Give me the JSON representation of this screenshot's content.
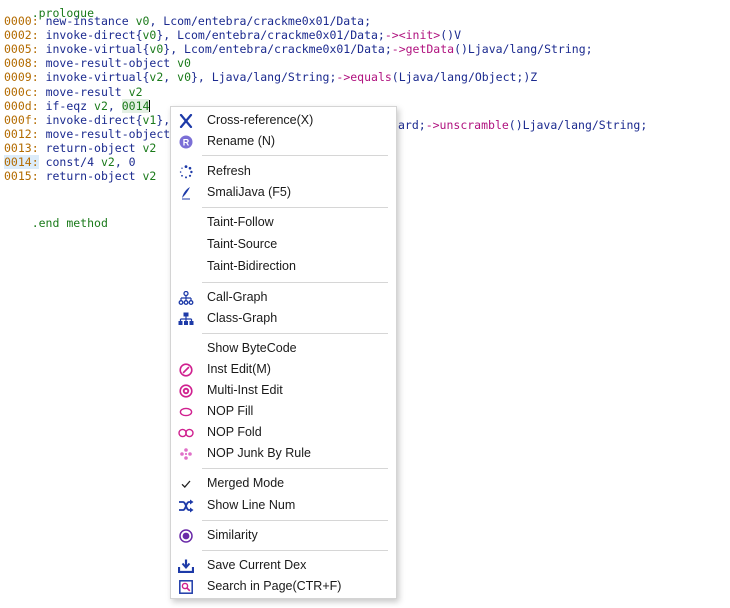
{
  "editor": {
    "header_fragment": ".prologue",
    "lines": [
      {
        "addr": "0000:",
        "parts": [
          {
            "t": "new-instance ",
            "c": "kw"
          },
          {
            "t": "v0",
            "c": "reg"
          },
          {
            "t": ", Lcom/entebra/crackme0x01/Data;",
            "c": "str"
          }
        ]
      },
      {
        "addr": "0002:",
        "parts": [
          {
            "t": "invoke-direct{",
            "c": "kw"
          },
          {
            "t": "v0",
            "c": "reg"
          },
          {
            "t": "}, Lcom/entebra/crackme0x01/Data;",
            "c": "str"
          },
          {
            "t": "-><init>",
            "c": "fn"
          },
          {
            "t": "()V",
            "c": "str"
          }
        ]
      },
      {
        "addr": "0005:",
        "parts": [
          {
            "t": "invoke-virtual{",
            "c": "kw"
          },
          {
            "t": "v0",
            "c": "reg"
          },
          {
            "t": "}, Lcom/entebra/crackme0x01/Data;",
            "c": "str"
          },
          {
            "t": "->getData",
            "c": "fn"
          },
          {
            "t": "()Ljava/lang/String;",
            "c": "str"
          }
        ]
      },
      {
        "addr": "0008:",
        "parts": [
          {
            "t": "move-result-object ",
            "c": "kw"
          },
          {
            "t": "v0",
            "c": "reg"
          }
        ]
      },
      {
        "addr": "0009:",
        "parts": [
          {
            "t": "invoke-virtual{",
            "c": "kw"
          },
          {
            "t": "v2",
            "c": "reg"
          },
          {
            "t": ", ",
            "c": "kw"
          },
          {
            "t": "v0",
            "c": "reg"
          },
          {
            "t": "}, Ljava/lang/String;",
            "c": "str"
          },
          {
            "t": "->equals",
            "c": "fn"
          },
          {
            "t": "(Ljava/lang/Object;)Z",
            "c": "str"
          }
        ]
      },
      {
        "addr": "000c:",
        "parts": [
          {
            "t": "move-result ",
            "c": "kw"
          },
          {
            "t": "v2",
            "c": "reg"
          }
        ]
      },
      {
        "addr": "000d:",
        "parts": [
          {
            "t": "if-eqz ",
            "c": "kw"
          },
          {
            "t": "v2",
            "c": "reg"
          },
          {
            "t": ", ",
            "c": "kw"
          },
          {
            "t": "0014",
            "c": "num hl"
          }
        ]
      },
      {
        "addr": "000f:",
        "parts": [
          {
            "t": "invoke-direct{",
            "c": "kw"
          },
          {
            "t": "v1",
            "c": "reg"
          },
          {
            "t": "},",
            "c": "kw"
          }
        ]
      },
      {
        "addr": "0012:",
        "parts": [
          {
            "t": "move-result-object",
            "c": "kw"
          }
        ]
      },
      {
        "addr": "0013:",
        "parts": [
          {
            "t": "return-object ",
            "c": "kw"
          },
          {
            "t": "v2",
            "c": "reg"
          }
        ]
      },
      {
        "addr": "0014:",
        "addr_hl": true,
        "parts": [
          {
            "t": "const/4 ",
            "c": "kw"
          },
          {
            "t": "v2",
            "c": "reg"
          },
          {
            "t": ", 0",
            "c": "kw"
          }
        ]
      },
      {
        "addr": "0015:",
        "parts": [
          {
            "t": "return-object ",
            "c": "kw"
          },
          {
            "t": "v2",
            "c": "reg"
          }
        ]
      }
    ],
    "line_000f_tail": "ard;->unscramble()Ljava/lang/String;",
    "line_000f_tail_parts": [
      {
        "t": "ard;",
        "c": "str"
      },
      {
        "t": "->unscramble",
        "c": "fn"
      },
      {
        "t": "()Ljava/lang/String;",
        "c": "str"
      }
    ],
    "end_directive": ".end method"
  },
  "menu": {
    "items": [
      {
        "label": "Cross-reference(X)",
        "icon": "cross-reference-icon"
      },
      {
        "label": "Rename (N)",
        "icon": "rename-icon"
      },
      {
        "label": "Refresh",
        "icon": "refresh-icon"
      },
      {
        "label": "SmaliJava (F5)",
        "icon": "smalijava-icon"
      },
      {
        "label": "Taint-Follow",
        "icon": ""
      },
      {
        "label": "Taint-Source",
        "icon": ""
      },
      {
        "label": "Taint-Bidirection",
        "icon": ""
      },
      {
        "label": "Call-Graph",
        "icon": "call-graph-icon"
      },
      {
        "label": "Class-Graph",
        "icon": "class-graph-icon"
      },
      {
        "label": "Show ByteCode",
        "icon": ""
      },
      {
        "label": "Inst Edit(M)",
        "icon": "inst-edit-icon"
      },
      {
        "label": "Multi-Inst Edit",
        "icon": "multi-inst-edit-icon"
      },
      {
        "label": "NOP Fill",
        "icon": "nop-fill-icon"
      },
      {
        "label": "NOP Fold",
        "icon": "nop-fold-icon"
      },
      {
        "label": "NOP Junk By Rule",
        "icon": "nop-junk-icon"
      },
      {
        "label": "Merged Mode",
        "icon": "checkmark-icon",
        "checked": true
      },
      {
        "label": "Show Line Num",
        "icon": "shuffle-icon"
      },
      {
        "label": "Similarity",
        "icon": "similarity-icon"
      },
      {
        "label": "Save Current Dex",
        "icon": "save-icon"
      },
      {
        "label": "Search in Page(CTR+F)",
        "icon": "search-page-icon"
      }
    ]
  },
  "colors": {
    "accent_blue": "#1d3aa8",
    "accent_pink": "#d0208f",
    "address": "#b36b00",
    "register": "#1a7a1a",
    "method": "#b0127f"
  }
}
